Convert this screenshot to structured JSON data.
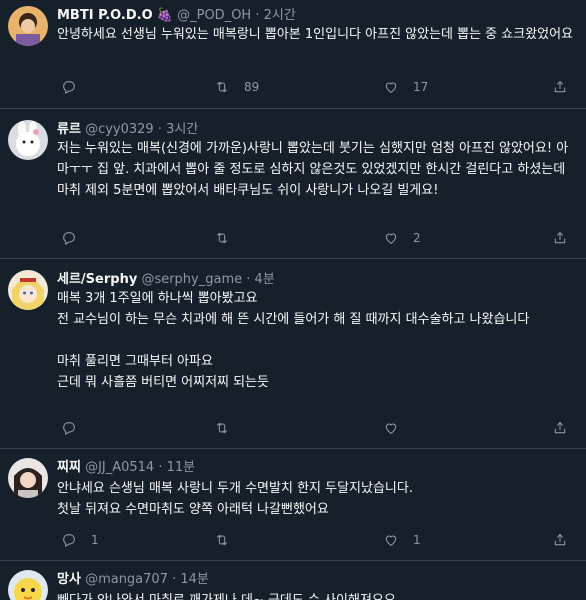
{
  "tweets": [
    {
      "name": "MBTI P.O.D.O",
      "handle": "@_POD_OH",
      "sep": "·",
      "time": "2시간",
      "text": "안녕하세요 선생님 누워있는 매복랑니 뽑아본 1인입니다 아프진 않았는데 뽑는 중 쇼크왔었어요",
      "replies": "",
      "retweets": "89",
      "likes": "17"
    },
    {
      "name": "류르",
      "handle": "@cyy0329",
      "sep": "·",
      "time": "3시간",
      "text": "저는 누워있는 매복(신경에 가까운)사랑니 뽑았는데 붓기는 심했지만 엄청 아프진 않았어요! 아마ㅜㅜ 집 앞. 치과에서 뽑아 줄 정도로 심하지 않은것도 있었겠지만 한시간 걸린다고 하셨는데 마취 제외 5분면에 뽑았어서 배타쿠님도 쉬이 사랑니가 나오길 빌게요!",
      "replies": "",
      "retweets": "",
      "likes": "2"
    },
    {
      "name": "세르/Serphy",
      "handle": "@serphy_game",
      "sep": "·",
      "time": "4분",
      "text": "매복 3개 1주일에 하나씩 뽑아봤고요\n전 교수님이 하는 무슨 치과에 해 뜬 시간에 들어가 해 질 때까지 대수술하고 나왔습니다\n\n마취 풀리면 그때부터 아파요\n근데 뭐 사흘쯤 버티면 어찌저찌 되는듯",
      "replies": "",
      "retweets": "",
      "likes": ""
    },
    {
      "name": "찌찌",
      "handle": "@JJ_A0514",
      "sep": "·",
      "time": "11분",
      "text": "안냐세요 슨생님 매복 사랑니 두개 수면발치 한지 두달지났습니다.\n첫날 뒤져요 수면마취도 양쪽 아래턱 나갈뻔했어요",
      "replies": "1",
      "retweets": "",
      "likes": "1"
    },
    {
      "name": "망사",
      "handle": "@manga707",
      "sep": "·",
      "time": "14분",
      "text": "빼다가 안나와서 마취로 깨가제나 데~ 근데도 슈 사이해져요오",
      "replies": "",
      "retweets": "",
      "likes": ""
    }
  ],
  "colors": {
    "background": "#15202b",
    "muted": "#8b98a5",
    "divider": "#38444d"
  }
}
